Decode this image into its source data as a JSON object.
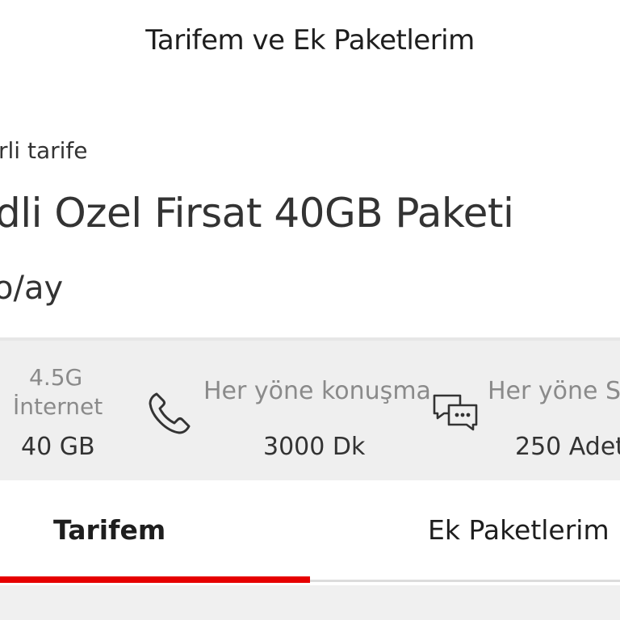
{
  "header": {
    "title": "Tarifem ve Ek Paketlerim"
  },
  "plan": {
    "caption": "rli tarife",
    "name": "dli Ozel Firsat 40GB Paketi",
    "price": "o/ay"
  },
  "benefits": [
    {
      "label_line1": "4.5G",
      "label_line2": "İnternet",
      "value": "40 GB",
      "icon": "internet-icon"
    },
    {
      "label": "Her yöne konuşma",
      "value": "3000 Dk",
      "icon": "phone-icon"
    },
    {
      "label": "Her yöne SM",
      "value": "250 Adet",
      "icon": "sms-chat-icon"
    }
  ],
  "tabs": [
    {
      "label": "Tarifem",
      "active": true
    },
    {
      "label": "Ek Paketlerim",
      "active": false
    }
  ],
  "colors": {
    "accent": "#e60000",
    "benefits_bg": "#efefef",
    "muted_text": "#8a8a8a"
  }
}
